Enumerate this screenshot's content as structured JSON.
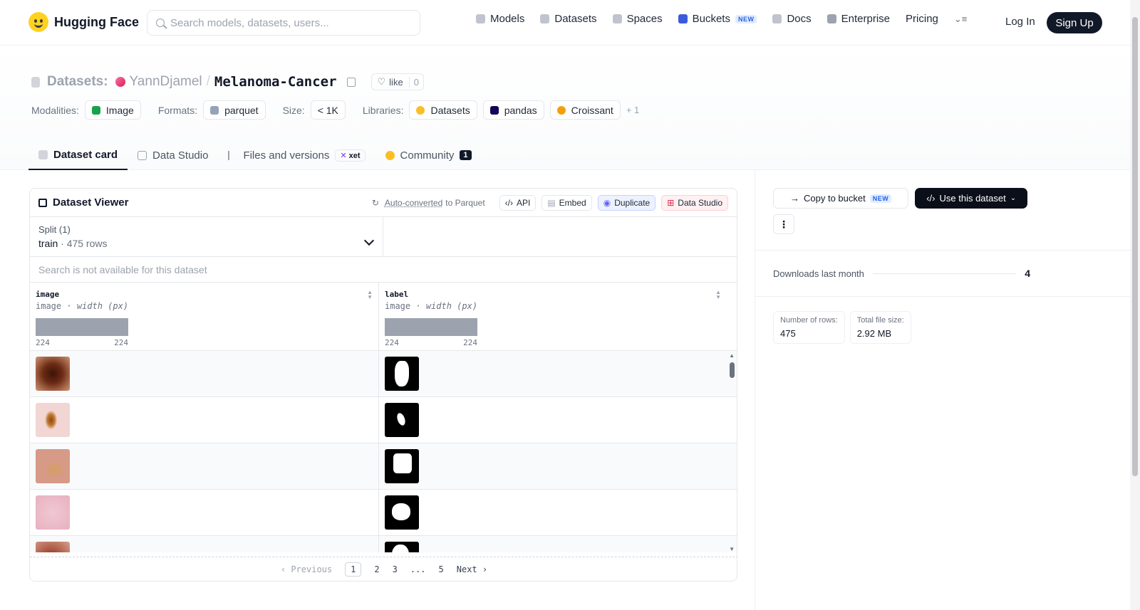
{
  "nav": {
    "brand": "Hugging Face",
    "search_placeholder": "Search models, datasets, users...",
    "links": [
      {
        "label": "Models",
        "icon": "models-icon",
        "color": "#9ca3af"
      },
      {
        "label": "Datasets",
        "icon": "datasets-icon",
        "color": "#9ca3af"
      },
      {
        "label": "Spaces",
        "icon": "spaces-icon",
        "color": "#9ca3af"
      },
      {
        "label": "Buckets",
        "icon": "buckets-icon",
        "color": "#3b5bdb",
        "badge": "NEW"
      },
      {
        "label": "Docs",
        "icon": "docs-icon",
        "color": "#9ca3af"
      },
      {
        "label": "Enterprise",
        "icon": "enterprise-icon",
        "color": "#6b7280"
      },
      {
        "label": "Pricing"
      }
    ],
    "login": "Log In",
    "signup": "Sign Up"
  },
  "header": {
    "kind": "Datasets:",
    "owner": "YannDjamel",
    "separator": "/",
    "repo": "Melanoma-Cancer",
    "like_label": "like",
    "like_count": "0",
    "meta": {
      "modalities_label": "Modalities:",
      "modality": "Image",
      "formats_label": "Formats:",
      "format": "parquet",
      "size_label": "Size:",
      "size": "< 1K",
      "libraries_label": "Libraries:",
      "libraries": [
        "Datasets",
        "pandas",
        "Croissant"
      ],
      "more": "+ 1"
    },
    "tabs": [
      {
        "label": "Dataset card",
        "active": true
      },
      {
        "label": "Data Studio"
      },
      {
        "label": "Files and versions",
        "badge": "xet"
      },
      {
        "label": "Community",
        "count": "1"
      }
    ]
  },
  "viewer": {
    "title": "Dataset Viewer",
    "auto_converted": "Auto-converted",
    "to_parquet": "to Parquet",
    "api": "API",
    "embed": "Embed",
    "duplicate": "Duplicate",
    "data_studio": "Data Studio",
    "split_label": "Split (1)",
    "split_name": "train",
    "split_rows": "475 rows",
    "search_na": "Search is not available for this dataset",
    "columns": [
      {
        "name": "image",
        "type": "image",
        "stat": "width (px)",
        "min": "224",
        "max": "224"
      },
      {
        "name": "label",
        "type": "image",
        "stat": "width (px)",
        "min": "224",
        "max": "224"
      }
    ],
    "pager": {
      "prev": "Previous",
      "pages": [
        "1",
        "2",
        "3",
        "...",
        "5"
      ],
      "current": "1",
      "next": "Next"
    }
  },
  "sidebar": {
    "copy_bucket": "Copy to bucket",
    "copy_badge": "NEW",
    "use_dataset": "Use this dataset",
    "downloads_label": "Downloads last month",
    "downloads_value": "4",
    "rows_label": "Number of rows:",
    "rows_value": "475",
    "size_label": "Total file size:",
    "size_value": "2.92 MB"
  }
}
